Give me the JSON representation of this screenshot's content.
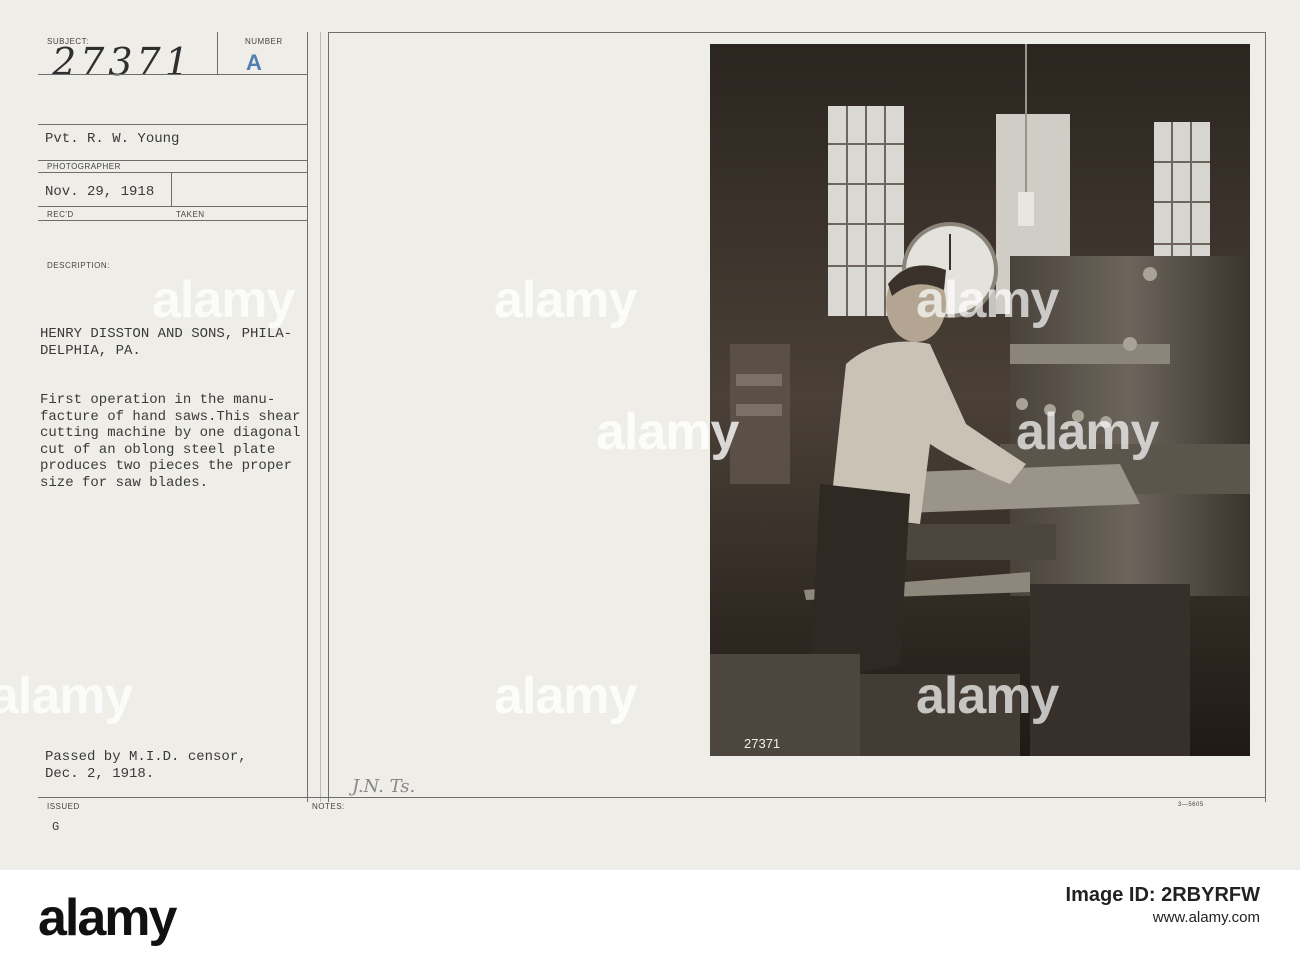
{
  "card": {
    "subject_label": "SUBJECT:",
    "number_label": "NUMBER",
    "subject_value": "27371",
    "number_value": "A",
    "photographer": "Pvt. R. W. Young",
    "photographer_label": "PHOTOGRAPHER",
    "received_date": "Nov. 29, 1918",
    "received_label": "REC'D",
    "taken_label": "TAKEN",
    "description_label": "DESCRIPTION:",
    "description_heading": "HENRY DISSTON AND SONS, PHILA-\nDELPHIA, PA.",
    "description_body": "First operation in the manu-\nfacture of hand saws.This shear\ncutting machine by one diagonal\ncut of an oblong steel plate\nproduces two pieces the proper\nsize for saw blades.",
    "censor_note": "Passed by M.I.D. censor,\nDec. 2, 1918.",
    "issued_label": "ISSUED",
    "issued_value": "G",
    "notes_label": "NOTES:",
    "notes_handwriting": "J.N. Ts.",
    "form_number": "3—5605",
    "photo_negative_number": "27371"
  },
  "watermark": {
    "text": "alamy"
  },
  "banner": {
    "logo": "alamy",
    "image_id_label": "Image ID: 2RBYRFW",
    "url": "www.alamy.com"
  },
  "colors": {
    "card_background": "#efede8",
    "rule_lines": "#6d6d6d",
    "number_accent": "#4f7fb0",
    "photo_tone": "#3b332b",
    "banner_background": "#ffffff"
  }
}
